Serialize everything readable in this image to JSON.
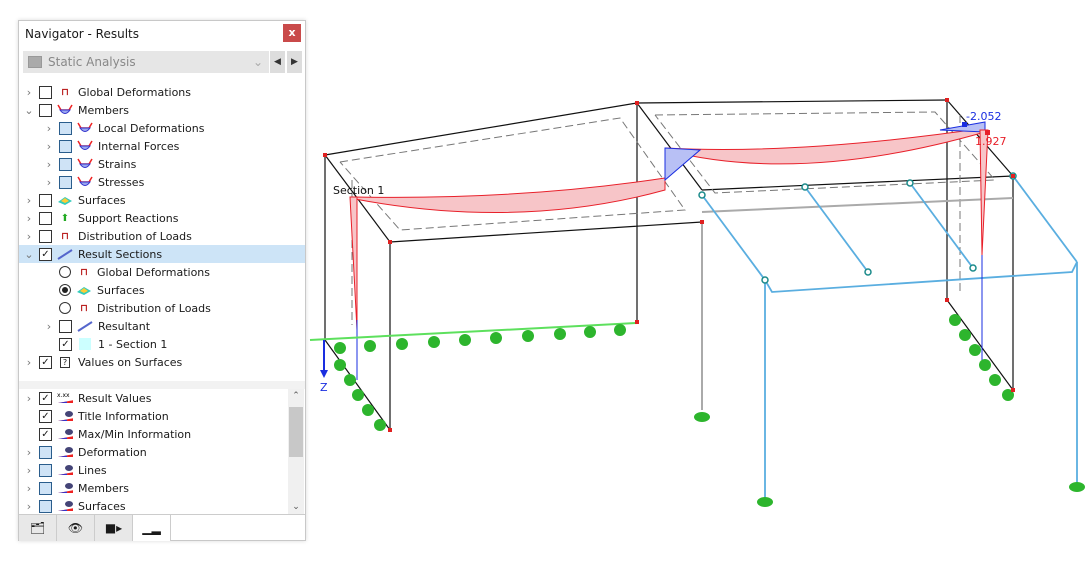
{
  "navigator": {
    "title": "Navigator - Results",
    "close_label": "x",
    "analysis_select": "Static Analysis",
    "prev_label": "◀",
    "next_label": "▶",
    "tree": [
      {
        "label": "Global Deformations",
        "level": 0,
        "expander": "›",
        "control": "checkbox",
        "checked": false,
        "icon": "global-deformation-icon"
      },
      {
        "label": "Members",
        "level": 0,
        "expander": "⌄",
        "control": "checkbox",
        "checked": false,
        "icon": "member-diagram-icon"
      },
      {
        "label": "Local Deformations",
        "level": 1,
        "expander": "›",
        "control": "checkbox-partial",
        "checked": false,
        "icon": "member-diagram-icon"
      },
      {
        "label": "Internal Forces",
        "level": 1,
        "expander": "›",
        "control": "checkbox-partial",
        "checked": false,
        "icon": "member-diagram-icon"
      },
      {
        "label": "Strains",
        "level": 1,
        "expander": "›",
        "control": "checkbox-partial",
        "checked": false,
        "icon": "member-diagram-icon"
      },
      {
        "label": "Stresses",
        "level": 1,
        "expander": "›",
        "control": "checkbox-partial",
        "checked": false,
        "icon": "member-diagram-icon"
      },
      {
        "label": "Surfaces",
        "level": 0,
        "expander": "›",
        "control": "checkbox",
        "checked": false,
        "icon": "surface-icon"
      },
      {
        "label": "Support Reactions",
        "level": 0,
        "expander": "›",
        "control": "checkbox",
        "checked": false,
        "icon": "support-icon"
      },
      {
        "label": "Distribution of Loads",
        "level": 0,
        "expander": "›",
        "control": "checkbox",
        "checked": false,
        "icon": "load-distribution-icon"
      },
      {
        "label": "Result Sections",
        "level": 0,
        "expander": "⌄",
        "control": "checkbox",
        "checked": true,
        "icon": "result-section-icon",
        "selected": true
      },
      {
        "label": "Global Deformations",
        "level": 1,
        "expander": "",
        "control": "radio",
        "checked": false,
        "icon": "global-deformation-icon"
      },
      {
        "label": "Surfaces",
        "level": 1,
        "expander": "",
        "control": "radio",
        "checked": true,
        "icon": "surface-icon"
      },
      {
        "label": "Distribution of Loads",
        "level": 1,
        "expander": "",
        "control": "radio",
        "checked": false,
        "icon": "load-distribution-icon"
      },
      {
        "label": "Resultant",
        "level": 1,
        "expander": "›",
        "control": "checkbox",
        "checked": false,
        "icon": "result-section-icon"
      },
      {
        "label": "1 - Section 1",
        "level": 1,
        "expander": "",
        "control": "checkbox",
        "checked": true,
        "icon": "section-color-icon"
      },
      {
        "label": "Values on Surfaces",
        "level": 0,
        "expander": "›",
        "control": "checkbox",
        "checked": true,
        "icon": "question-icon"
      }
    ],
    "display_tree": [
      {
        "label": "Result Values",
        "expander": "›",
        "control": "checkbox",
        "checked": true,
        "icon": "result-values-icon"
      },
      {
        "label": "Title Information",
        "expander": "",
        "control": "checkbox",
        "checked": true,
        "icon": "display-eye-icon"
      },
      {
        "label": "Max/Min Information",
        "expander": "",
        "control": "checkbox",
        "checked": true,
        "icon": "display-eye-icon"
      },
      {
        "label": "Deformation",
        "expander": "›",
        "control": "checkbox-partial",
        "checked": false,
        "icon": "display-eye-icon"
      },
      {
        "label": "Lines",
        "expander": "›",
        "control": "checkbox-partial",
        "checked": false,
        "icon": "display-eye-icon"
      },
      {
        "label": "Members",
        "expander": "›",
        "control": "checkbox-partial",
        "checked": false,
        "icon": "display-eye-icon"
      },
      {
        "label": "Surfaces",
        "expander": "›",
        "control": "checkbox-partial",
        "checked": false,
        "icon": "display-eye-icon"
      }
    ],
    "tabs": [
      {
        "name": "data-tab",
        "icon": "folder-icon",
        "glyph": "🗂"
      },
      {
        "name": "view-tab",
        "icon": "eye-icon",
        "glyph": "👁"
      },
      {
        "name": "camera-tab",
        "icon": "camera-icon",
        "glyph": "■▸"
      },
      {
        "name": "results-tab",
        "icon": "results-icon",
        "glyph": "▁▂",
        "active": true
      }
    ]
  },
  "model": {
    "section_label": "Section 1",
    "max_value": "-2.052",
    "min_value": "1.927",
    "axis_label": "Z",
    "colors": {
      "positive": "#e8202a",
      "negative": "#1a2ee0",
      "support": "#2db52d",
      "steel_frame": "#5aaee0"
    }
  }
}
